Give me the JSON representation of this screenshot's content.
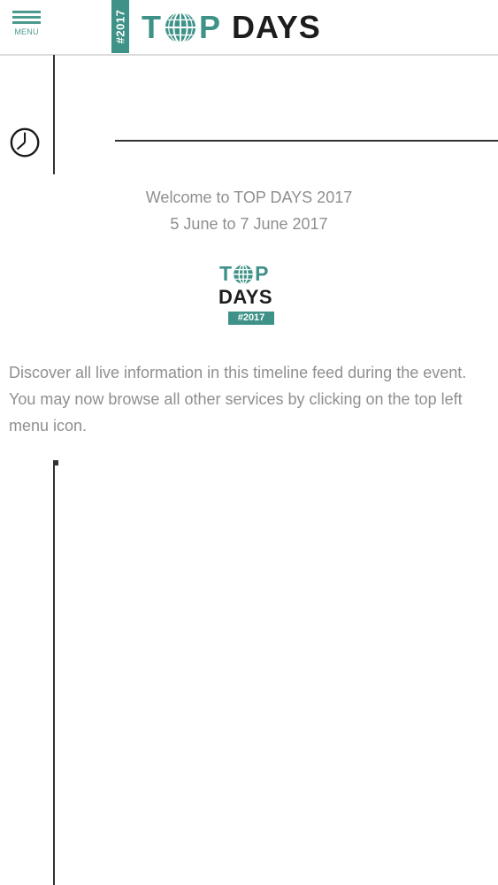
{
  "header": {
    "menu_label": "MENU",
    "year_tab": "#2017",
    "brand": {
      "t": "T",
      "p": "P",
      "days": "DAYS"
    }
  },
  "timeline": {
    "welcome_line1": "Welcome to TOP DAYS 2017",
    "welcome_line2": "5 June to 7 June 2017",
    "logo": {
      "t": "T",
      "p": "P",
      "days": "DAYS",
      "year": "#2017"
    },
    "intro": "Discover all live information in this timeline feed during the event. You may now browse all other services by clicking on the top left menu icon."
  },
  "colors": {
    "brand_teal": "#3e9287",
    "text_gray": "#8f8f8f",
    "line_dark": "#333333"
  },
  "icons": [
    "menu-icon",
    "globe-icon",
    "clock-icon"
  ]
}
